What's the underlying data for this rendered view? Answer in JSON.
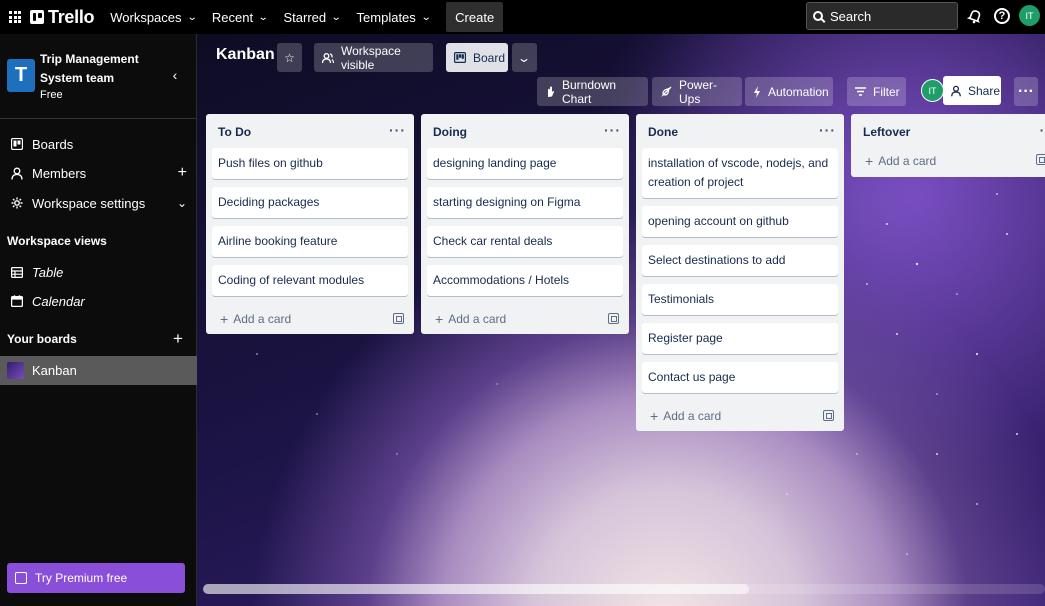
{
  "topbar": {
    "logo": "Trello",
    "nav": [
      {
        "label": "Workspaces"
      },
      {
        "label": "Recent"
      },
      {
        "label": "Starred"
      },
      {
        "label": "Templates"
      }
    ],
    "create_label": "Create",
    "search_placeholder": "Search",
    "avatar_initials": "IT"
  },
  "sidebar": {
    "workspace_initial": "T",
    "workspace_name": "Trip Management System team",
    "workspace_plan": "Free",
    "items": [
      {
        "label": "Boards",
        "icon": "board-icon"
      },
      {
        "label": "Members",
        "icon": "person-icon"
      },
      {
        "label": "Workspace settings",
        "icon": "gear-icon"
      }
    ],
    "views_heading": "Workspace views",
    "views": [
      {
        "label": "Table",
        "icon": "table-icon"
      },
      {
        "label": "Calendar",
        "icon": "calendar-icon"
      }
    ],
    "boards_heading": "Your boards",
    "boards": [
      {
        "label": "Kanban"
      }
    ],
    "premium_label": "Try Premium free"
  },
  "board": {
    "title": "Kanban",
    "visibility_label": "Workspace visible",
    "view_label": "Board",
    "burndown_label": "Burndown Chart",
    "powerups_label": "Power-Ups",
    "automation_label": "Automation",
    "filter_label": "Filter",
    "share_label": "Share",
    "member_initials": "IT"
  },
  "lists": [
    {
      "title": "To Do",
      "cards": [
        "Push files on github",
        "Deciding packages",
        "Airline booking feature",
        "Coding of relevant modules"
      ],
      "add_label": "Add a card"
    },
    {
      "title": "Doing",
      "cards": [
        "designing landing page",
        "starting designing on Figma",
        "Check car rental deals",
        "Accommodations / Hotels"
      ],
      "add_label": "Add a card"
    },
    {
      "title": "Done",
      "cards": [
        "installation of vscode, nodejs, and creation of project",
        "opening account on github",
        "Select destinations to add",
        "Testimonials",
        "Register page",
        "Contact us page"
      ],
      "add_label": "Add a card"
    },
    {
      "title": "Leftover",
      "cards": [],
      "add_label": "Add a card"
    }
  ],
  "colors": {
    "topbar_bg": "#000000",
    "list_bg": "#f1f2f4",
    "premium": "#8a4fd8",
    "avatar": "#1f9e69",
    "workspace_logo": "#1e6fbe"
  }
}
